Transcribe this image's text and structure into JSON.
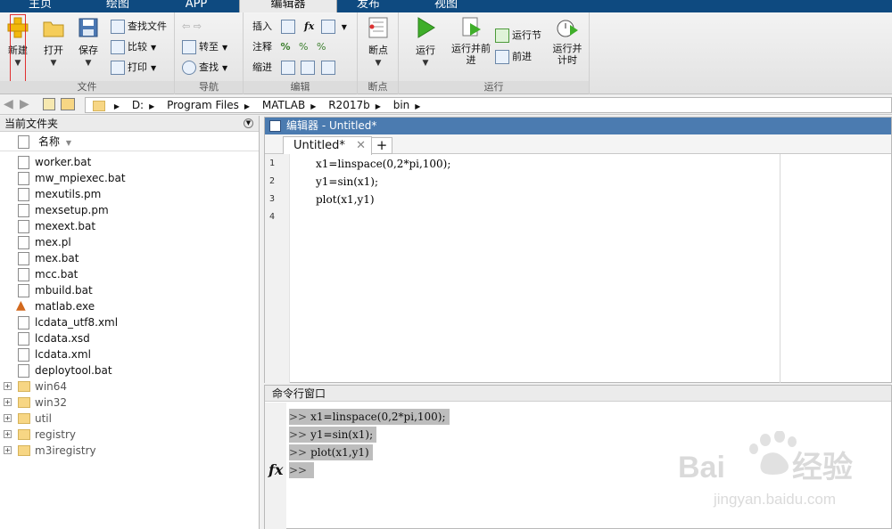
{
  "tabs": [
    "主页",
    "绘图",
    "APP",
    "编辑器",
    "发布",
    "视图"
  ],
  "ribbon": {
    "file_group": {
      "label": "文件",
      "new": "新建",
      "open": "打开",
      "save": "保存",
      "find_file": "查找文件",
      "compare": "比较",
      "print": "打印"
    },
    "nav_group": {
      "label": "导航",
      "goto": "转至",
      "find": "查找"
    },
    "edit_group": {
      "label": "编辑",
      "insert": "插入",
      "comment": "注释",
      "indent": "缩进",
      "fx": "fx"
    },
    "breakpoint_group": {
      "label": "断点",
      "breakpoints": "断点"
    },
    "run_group": {
      "label": "运行",
      "run": "运行",
      "run_advance": "运行并前进",
      "run_section": "运行节",
      "advance": "前进",
      "run_time": "运行并计时"
    }
  },
  "address": {
    "crumbs": [
      "D:",
      "Program Files",
      "MATLAB",
      "R2017b",
      "bin"
    ]
  },
  "current_folder": {
    "title": "当前文件夹",
    "column": "名称",
    "files": [
      "worker.bat",
      "mw_mpiexec.bat",
      "mexutils.pm",
      "mexsetup.pm",
      "mexext.bat",
      "mex.pl",
      "mex.bat",
      "mcc.bat",
      "mbuild.bat",
      "matlab.exe",
      "lcdata_utf8.xml",
      "lcdata.xsd",
      "lcdata.xml",
      "deploytool.bat"
    ],
    "folders": [
      "win64",
      "win32",
      "util",
      "registry",
      "m3iregistry"
    ]
  },
  "editor": {
    "title": "编辑器 - Untitled*",
    "tab": "Untitled*",
    "line_numbers": [
      "1",
      "2",
      "3",
      "4"
    ],
    "lines": [
      "x1=linspace(0,2*pi,100);",
      "y1=sin(x1);",
      "plot(x1,y1)"
    ]
  },
  "command_window": {
    "title": "命令行窗口",
    "prompt": ">>",
    "fx": "fx",
    "lines": [
      "x1=linspace(0,2*pi,100);",
      "y1=sin(x1);",
      "plot(x1,y1)"
    ]
  },
  "watermark": {
    "brand": "Bai du 经验",
    "url": "jingyan.baidu.com"
  }
}
